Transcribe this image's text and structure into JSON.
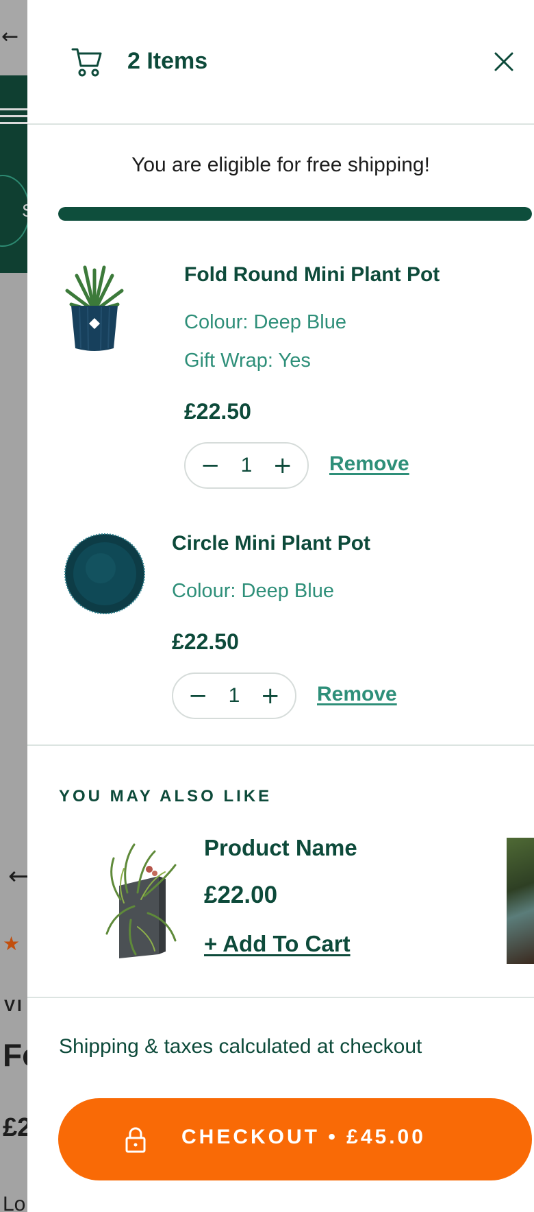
{
  "background": {
    "circle_text": "S",
    "vi_text": "VI",
    "title_fragment": "Fo",
    "price_fragment": "£2",
    "bottom_fragment": "Lo"
  },
  "cart": {
    "items_count_label": "2 Items",
    "free_shipping_message": "You are eligible for free shipping!",
    "shipping_progress_pct": 100,
    "items": [
      {
        "title": "Fold Round Mini Plant Pot",
        "options": [
          "Colour: Deep Blue",
          "Gift Wrap: Yes"
        ],
        "price": "£22.50",
        "quantity": "1",
        "remove_label": "Remove",
        "image": "plant-in-blue-pot"
      },
      {
        "title": "Circle Mini Plant Pot",
        "options": [
          "Colour: Deep Blue"
        ],
        "price": "£22.50",
        "quantity": "1",
        "remove_label": "Remove",
        "image": "round-deep-blue-pot-top-view"
      }
    ],
    "upsell": {
      "heading": "YOU MAY ALSO LIKE",
      "product": {
        "name": "Product Name",
        "price": "£22.00",
        "add_label": "+ Add To Cart",
        "image": "vertical-wall-planter"
      }
    },
    "tax_note": "Shipping & taxes calculated at checkout",
    "checkout_label": "CHECKOUT  •  £45.00"
  },
  "colors": {
    "brand_dark": "#0d4a3a",
    "accent_teal": "#2e8f79",
    "checkout_orange": "#f96a06"
  },
  "icons": [
    "cart-icon",
    "close-icon",
    "minus-icon",
    "plus-icon",
    "lock-icon"
  ]
}
